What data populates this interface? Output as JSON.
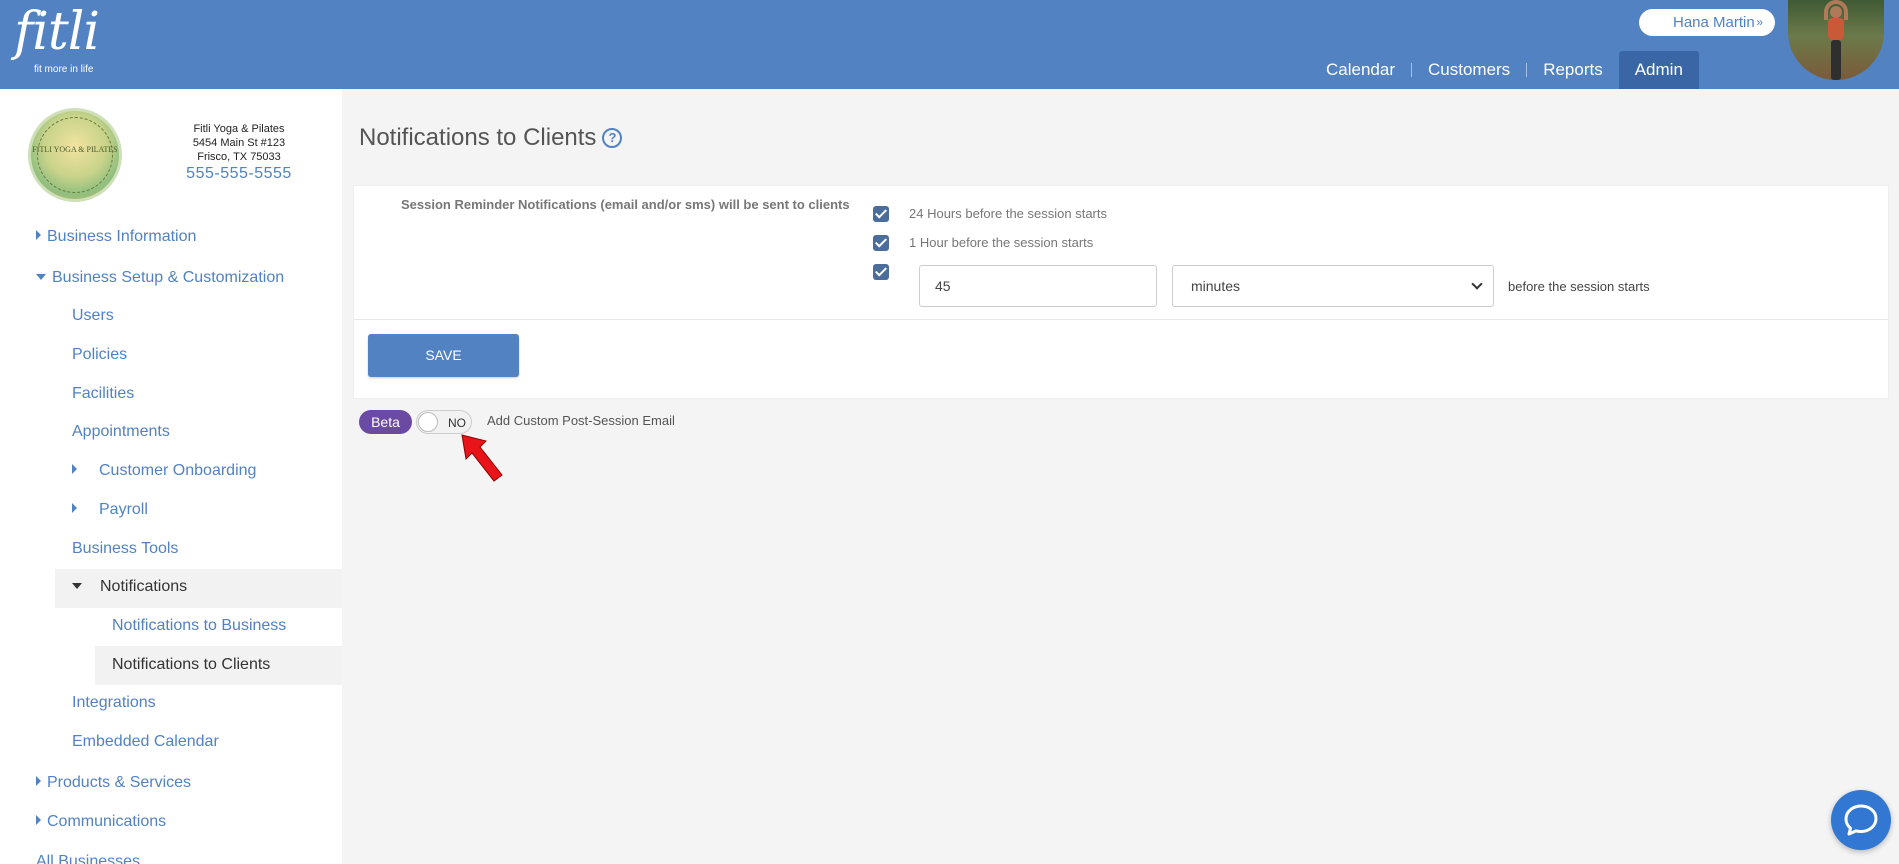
{
  "brand": {
    "name": "fitli",
    "tagline": "fit more in life"
  },
  "header": {
    "user_name": "Hana Martin",
    "nav": [
      {
        "label": "Calendar",
        "active": false
      },
      {
        "label": "Customers",
        "active": false
      },
      {
        "label": "Reports",
        "active": false
      },
      {
        "label": "Admin",
        "active": true
      }
    ]
  },
  "business": {
    "logo_text": "FITLI YOGA & PILATES",
    "name": "Fitli Yoga & Pilates",
    "address_line1": "5454 Main St #123",
    "address_line2": "Frisco, TX 75033",
    "phone": "555-555-5555"
  },
  "sidebar": {
    "business_information": "Business Information",
    "business_setup": "Business Setup & Customization",
    "users": "Users",
    "policies": "Policies",
    "facilities": "Facilities",
    "appointments": "Appointments",
    "customer_onboarding": "Customer Onboarding",
    "payroll": "Payroll",
    "business_tools": "Business Tools",
    "notifications": "Notifications",
    "notifications_to_business": "Notifications to Business",
    "notifications_to_clients": "Notifications to Clients",
    "integrations": "Integrations",
    "embedded_calendar": "Embedded Calendar",
    "products_services": "Products & Services",
    "communications": "Communications",
    "all_businesses": "All Businesses"
  },
  "main": {
    "title": "Notifications to Clients",
    "help_glyph": "?",
    "reminder_label": "Session Reminder Notifications (email and/or sms) will be sent to clients",
    "option_24h": "24 Hours before the session starts",
    "option_1h": "1 Hour before the session starts",
    "custom_value": "45",
    "custom_unit": "minutes",
    "custom_suffix": "before the session starts",
    "save_label": "SAVE",
    "beta_badge": "Beta",
    "toggle_state": "NO",
    "custom_email_label": "Add Custom Post-Session Email"
  },
  "colors": {
    "accent": "#5282c2",
    "beta": "#6b4aa3",
    "annotation_arrow": "#e8141a"
  }
}
